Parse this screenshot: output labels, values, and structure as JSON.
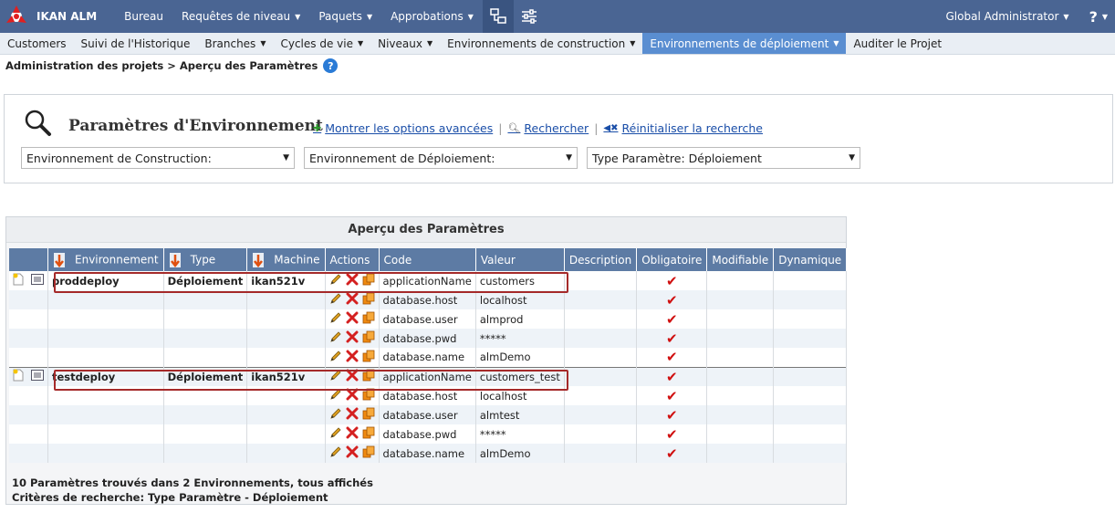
{
  "app": {
    "brand": "IKAN ALM"
  },
  "topnav": {
    "items": [
      {
        "label": "Bureau",
        "caret": false
      },
      {
        "label": "Requêtes de niveau",
        "caret": true
      },
      {
        "label": "Paquets",
        "caret": true
      },
      {
        "label": "Approbations",
        "caret": true
      }
    ],
    "user": "Global Administrator",
    "help": "?"
  },
  "subnav": {
    "items": [
      {
        "label": "Customers",
        "caret": false
      },
      {
        "label": "Suivi de l'Historique",
        "caret": false
      },
      {
        "label": "Branches",
        "caret": true
      },
      {
        "label": "Cycles de vie",
        "caret": true
      },
      {
        "label": "Niveaux",
        "caret": true
      },
      {
        "label": "Environnements de construction",
        "caret": true
      },
      {
        "label": "Environnements de déploiement",
        "caret": true,
        "active": true
      },
      {
        "label": "Auditer le Projet",
        "caret": false
      }
    ]
  },
  "breadcrumb": "Administration des projets > Aperçu des Paramètres",
  "search": {
    "title": "Paramètres d'Environnement",
    "links": {
      "advanced": "Montrer les options avancées",
      "search": "Rechercher",
      "reset": "Réinitialiser la recherche"
    },
    "selects": [
      "Environnement de Construction:",
      "Environnement de Déploiement:",
      "Type Paramètre: Déploiement"
    ]
  },
  "overview": {
    "title": "Aperçu des Paramètres",
    "columns": [
      "Environnement",
      "Type",
      "Machine",
      "Actions",
      "Code",
      "Valeur",
      "Description",
      "Obligatoire",
      "Modifiable",
      "Dynamique"
    ],
    "rows": [
      {
        "env": "proddeploy",
        "type": "Déploiement",
        "machine": "ikan521v",
        "code": "applicationName",
        "value": "customers",
        "first": true
      },
      {
        "env": "",
        "type": "",
        "machine": "",
        "code": "database.host",
        "value": "localhost"
      },
      {
        "env": "",
        "type": "",
        "machine": "",
        "code": "database.user",
        "value": "almprod"
      },
      {
        "env": "",
        "type": "",
        "machine": "",
        "code": "database.pwd",
        "value": "*****"
      },
      {
        "env": "",
        "type": "",
        "machine": "",
        "code": "database.name",
        "value": "almDemo"
      },
      {
        "env": "testdeploy",
        "type": "Déploiement",
        "machine": "ikan521v",
        "code": "applicationName",
        "value": "customers_test",
        "first": true
      },
      {
        "env": "",
        "type": "",
        "machine": "",
        "code": "database.host",
        "value": "localhost"
      },
      {
        "env": "",
        "type": "",
        "machine": "",
        "code": "database.user",
        "value": "almtest"
      },
      {
        "env": "",
        "type": "",
        "machine": "",
        "code": "database.pwd",
        "value": "*****"
      },
      {
        "env": "",
        "type": "",
        "machine": "",
        "code": "database.name",
        "value": "almDemo"
      }
    ],
    "summary_line1": "10 Paramètres trouvés dans 2 Environnements, tous affichés",
    "summary_line2": "Critères de recherche: Type Paramètre - Déploiement"
  },
  "colors": {
    "topbar": "#4a6593",
    "subnav_active": "#5a8ed1",
    "header": "#5d7ba4",
    "check": "#d01010",
    "highlight": "#a52a2a"
  }
}
